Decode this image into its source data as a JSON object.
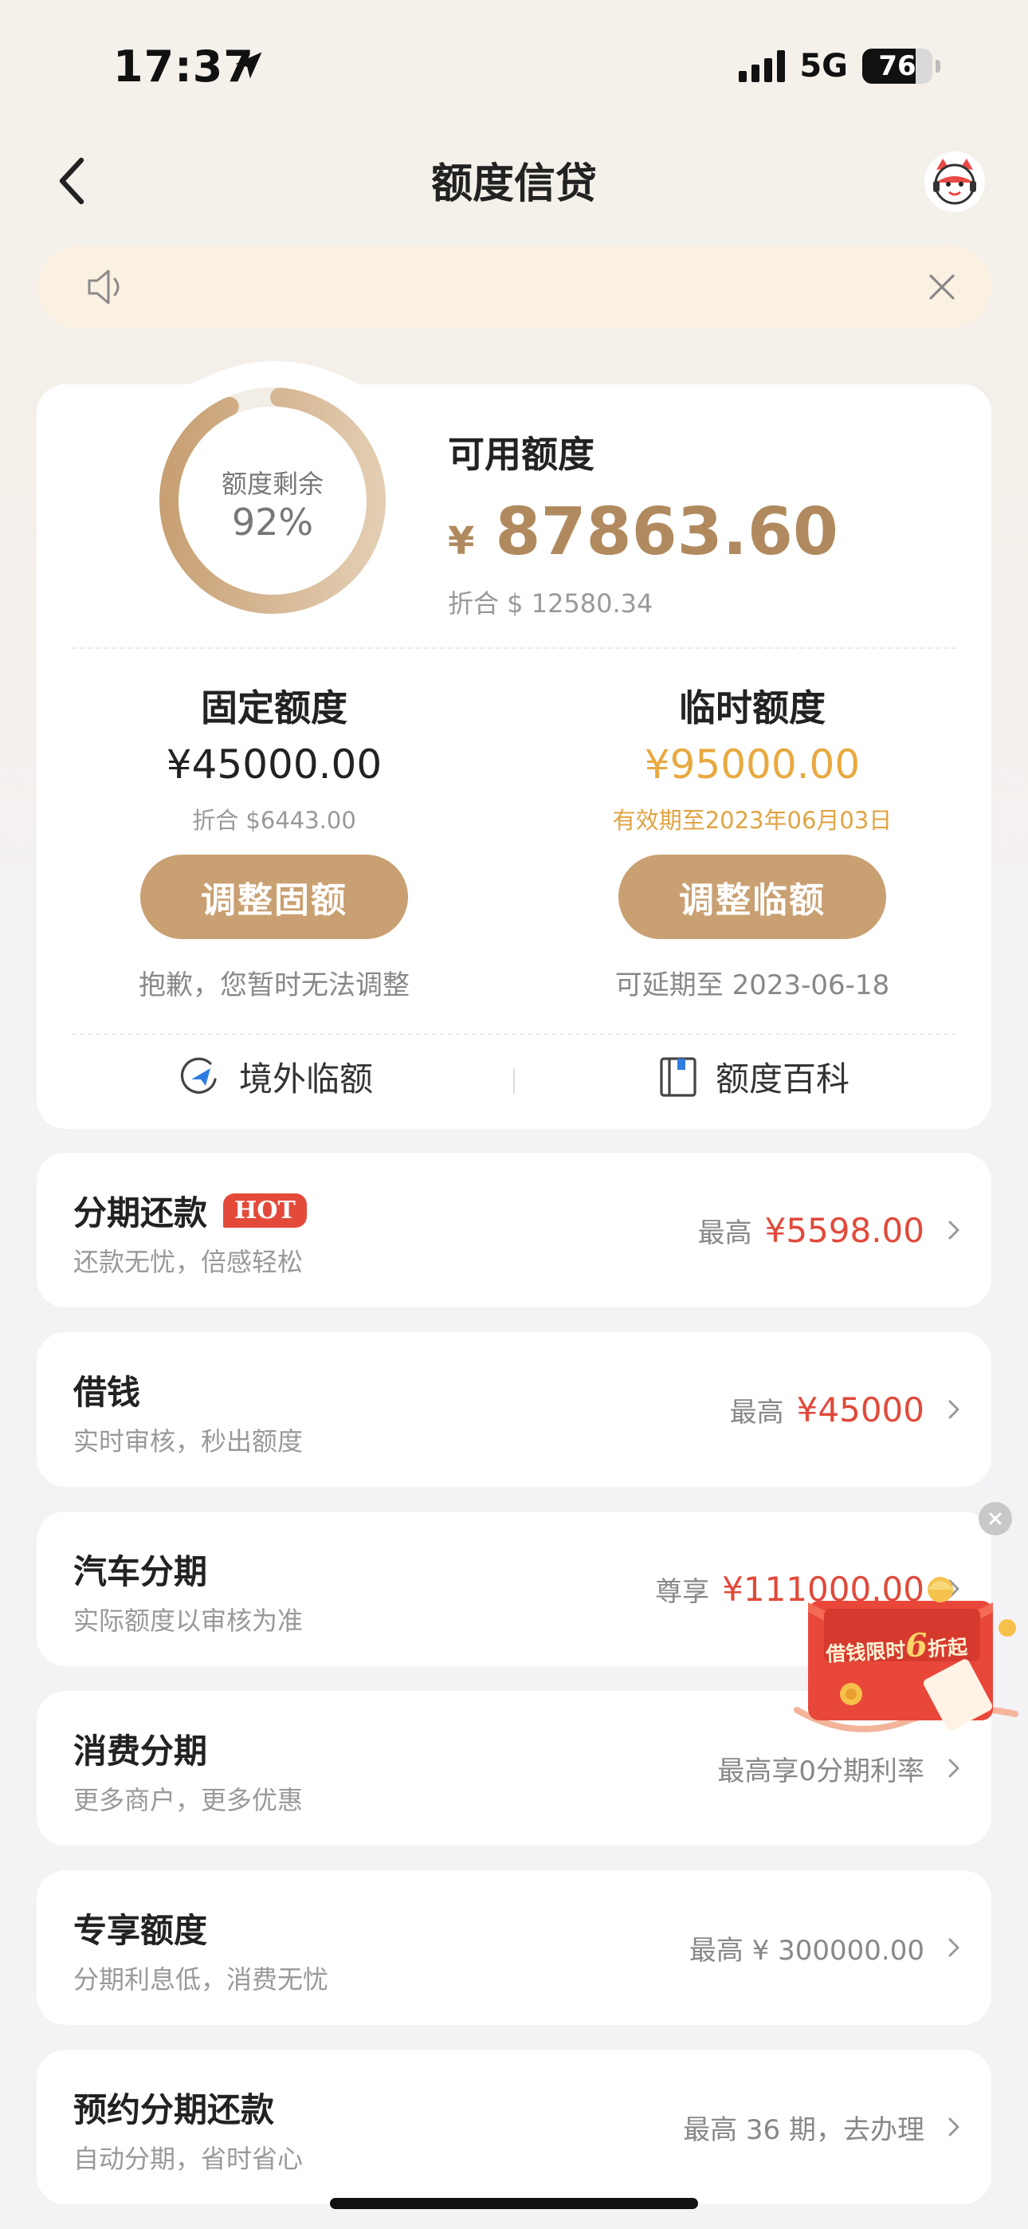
{
  "status": {
    "time": "17:37",
    "network": "5G",
    "battery": "76",
    "battery_level": 0.76
  },
  "nav": {
    "title": "额度信贷"
  },
  "notice": {
    "text": ""
  },
  "credit": {
    "ring_label": "额度剩余",
    "ring_percent": "92%",
    "ring_fraction": 0.92,
    "available_title": "可用额度",
    "currency_symbol": "¥",
    "available_amount": "87863.60",
    "available_usd": "折合 $ 12580.34",
    "fixed": {
      "title": "固定额度",
      "amount": "¥45000.00",
      "sub": "折合  $6443.00",
      "button": "调整固额",
      "note": "抱歉，您暂时无法调整"
    },
    "temp": {
      "title": "临时额度",
      "amount": "¥95000.00",
      "sub": "有效期至2023年06月03日",
      "button": "调整临额",
      "note": "可延期至 2023-06-18"
    },
    "links": {
      "overseas": "境外临额",
      "wiki": "额度百科"
    }
  },
  "items": [
    {
      "title": "分期还款",
      "badge": "HOT",
      "subtitle": "还款无忧，倍感轻松",
      "right_label": "最高",
      "right_value": "¥5598.00"
    },
    {
      "title": "借钱",
      "subtitle": "实时审核，秒出额度",
      "right_label": "最高",
      "right_value": "¥45000"
    },
    {
      "title": "汽车分期",
      "subtitle": "实际额度以审核为准",
      "right_label": "尊享",
      "right_value": "¥111000.00"
    },
    {
      "title": "消费分期",
      "subtitle": "更多商户，更多优惠",
      "right_label": "最高享0分期利率",
      "right_value": ""
    },
    {
      "title": "专享额度",
      "subtitle": "分期利息低，消费无忧",
      "right_label": "最高 ¥ 300000.00",
      "right_value": ""
    },
    {
      "title": "预约分期还款",
      "subtitle": "自动分期，省时省心",
      "right_label": "最高 36 期，去办理",
      "right_value": ""
    }
  ],
  "promo": {
    "text_before": "借钱限时",
    "text_big": "6",
    "text_after": "折起"
  },
  "colors": {
    "gold": "#c9a072",
    "red": "#e04a3a",
    "orange": "#e8a940"
  }
}
